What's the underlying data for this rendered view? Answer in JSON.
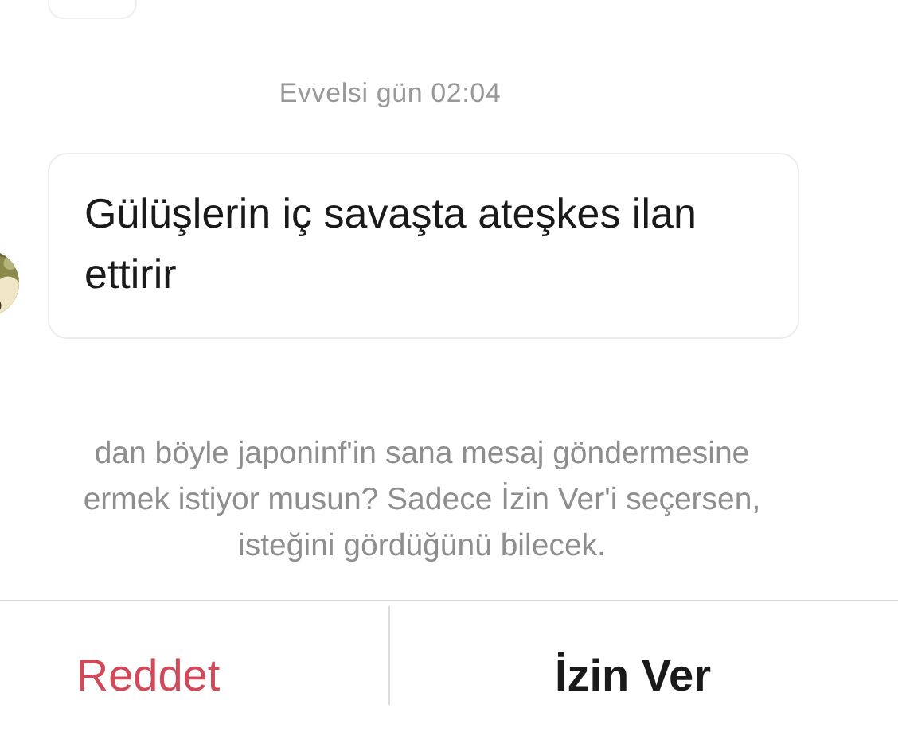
{
  "timestamp": "Evvelsi gün 02:04",
  "message": {
    "text": "Gülüşlerin iç savaşta ateşkes ilan ettirir"
  },
  "prompt_lines": [
    "dan böyle japoninf'in sana mesaj göndermesine",
    "ermek istiyor musun? Sadece İzin Ver'i seçersen,",
    "isteğini gördüğünü bilecek."
  ],
  "buttons": [
    {
      "label": "Reddet",
      "kind": "destructive"
    },
    {
      "label": "İzin Ver",
      "kind": "primary"
    }
  ]
}
